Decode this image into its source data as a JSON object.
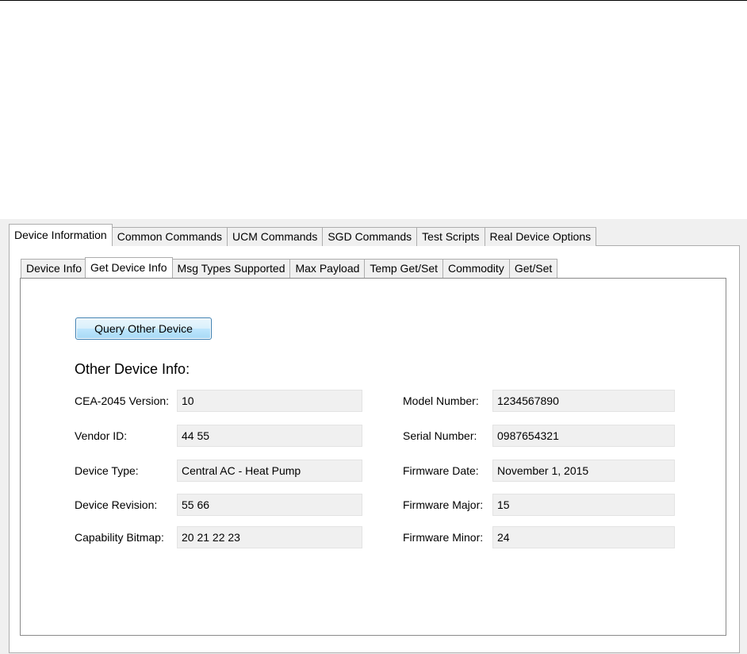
{
  "outer_tabs": [
    {
      "label": "Device Information",
      "active": true
    },
    {
      "label": "Common Commands",
      "active": false
    },
    {
      "label": "UCM Commands",
      "active": false
    },
    {
      "label": "SGD Commands",
      "active": false
    },
    {
      "label": "Test Scripts",
      "active": false
    },
    {
      "label": "Real Device Options",
      "active": false
    }
  ],
  "inner_tabs": [
    {
      "label": "Device Info",
      "active": false
    },
    {
      "label": "Get Device Info",
      "active": true
    },
    {
      "label": "Msg Types Supported",
      "active": false
    },
    {
      "label": "Max Payload",
      "active": false
    },
    {
      "label": "Temp Get/Set",
      "active": false
    },
    {
      "label": "Commodity",
      "active": false
    },
    {
      "label": "Get/Set",
      "active": false
    }
  ],
  "query_button_label": "Query Other Device",
  "section_title": "Other Device Info:",
  "left_fields": [
    {
      "label": "CEA-2045 Version:",
      "value": "10"
    },
    {
      "label": "Vendor ID:",
      "value": "44 55"
    },
    {
      "label": "Device Type:",
      "value": "Central AC - Heat Pump"
    },
    {
      "label": "Device Revision:",
      "value": "55 66"
    },
    {
      "label": "Capability Bitmap:",
      "value": "20 21 22 23"
    }
  ],
  "right_fields": [
    {
      "label": "Model Number:",
      "value": "1234567890"
    },
    {
      "label": "Serial Number:",
      "value": "0987654321"
    },
    {
      "label": "Firmware Date:",
      "value": "November 1, 2015"
    },
    {
      "label": "Firmware Major:",
      "value": "15"
    },
    {
      "label": "Firmware Minor:",
      "value": "24"
    }
  ]
}
